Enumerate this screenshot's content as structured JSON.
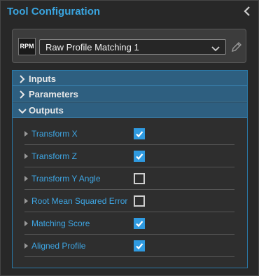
{
  "header": {
    "title": "Tool Configuration"
  },
  "tool": {
    "icon_label": "RPM",
    "selected_tool": "Raw Profile Matching 1"
  },
  "sections": [
    {
      "label": "Inputs",
      "expanded": false
    },
    {
      "label": "Parameters",
      "expanded": false
    },
    {
      "label": "Outputs",
      "expanded": true
    }
  ],
  "outputs": [
    {
      "label": "Transform X",
      "checked": true
    },
    {
      "label": "Transform Z",
      "checked": true
    },
    {
      "label": "Transform Y Angle",
      "checked": false
    },
    {
      "label": "Root Mean Squared Error",
      "checked": false
    },
    {
      "label": "Matching Score",
      "checked": true
    },
    {
      "label": "Aligned Profile",
      "checked": true
    }
  ],
  "colors": {
    "accent": "#3aa5e0",
    "section_header": "#2e5f80",
    "checkbox_on": "#2f9ae0"
  }
}
